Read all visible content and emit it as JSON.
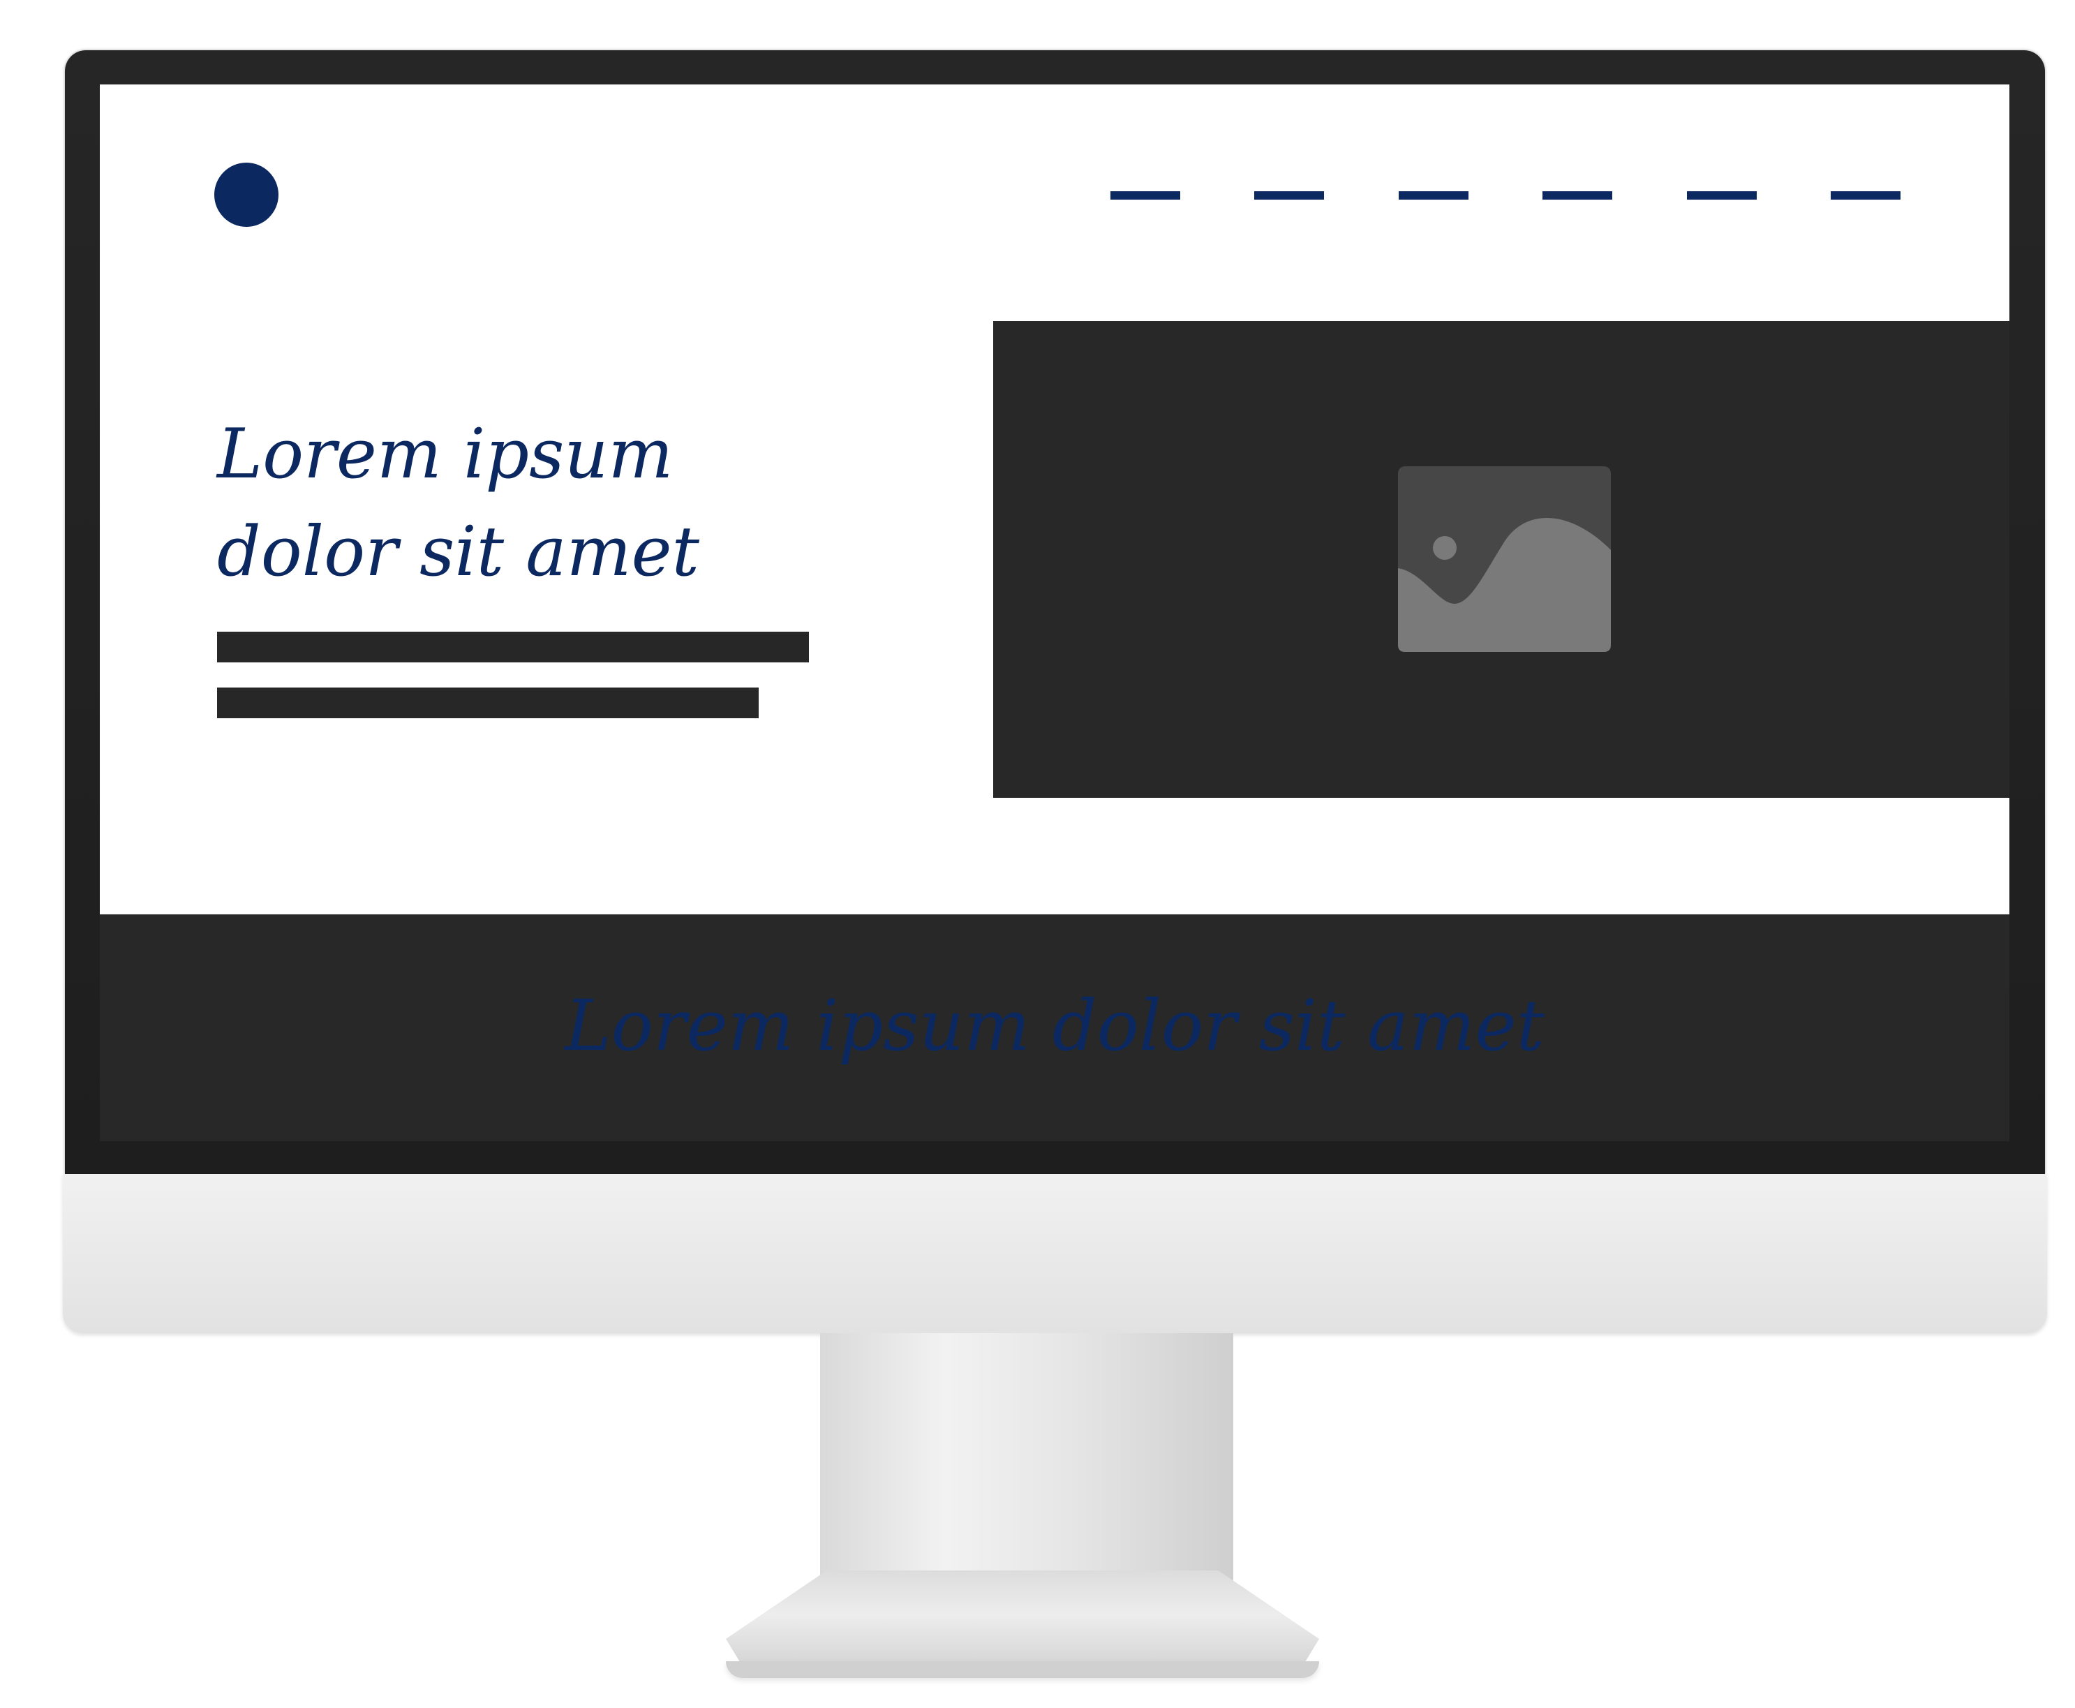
{
  "hero": {
    "title": "Lorem ipsum dolor sit amet"
  },
  "nav": {
    "item_count": 6
  },
  "footer": {
    "text": "Lorem ipsum dolor sit amet"
  },
  "colors": {
    "brand": "#0b2860",
    "dark_panel": "#282828",
    "text_placeholder": "#272727",
    "image_placeholder_tile": "#474747",
    "image_placeholder_art": "#7a7a7a"
  },
  "icons": {
    "logo": "circle-logo-icon",
    "image": "image-placeholder-icon"
  }
}
